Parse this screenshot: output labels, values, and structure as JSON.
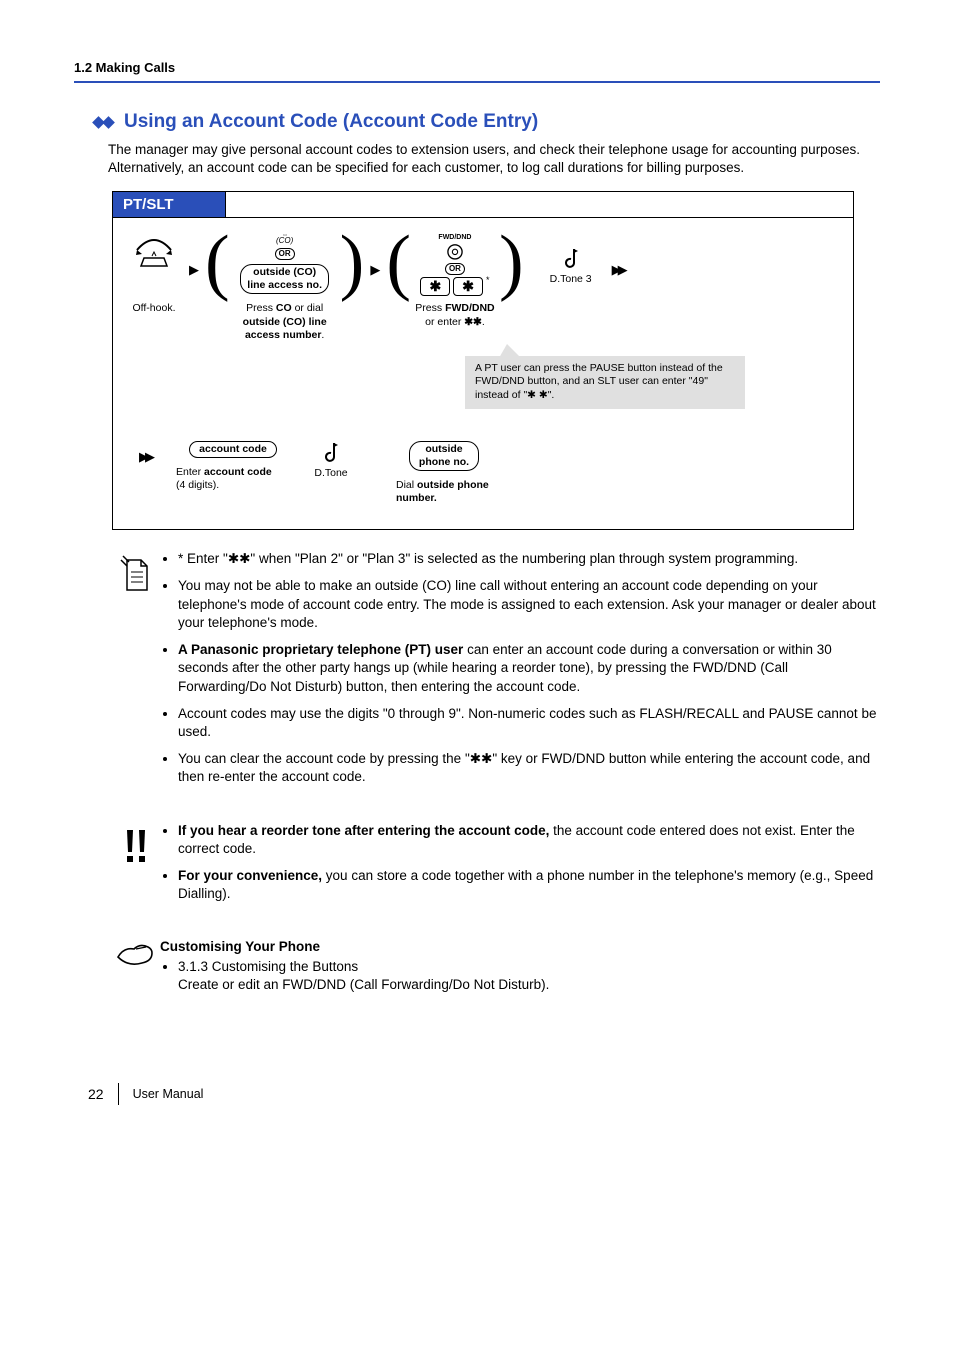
{
  "header": {
    "breadcrumb": "1.2 Making Calls"
  },
  "title": "Using an Account Code (Account Code Entry)",
  "intro": "The manager may give personal account codes to extension users, and check their telephone usage for accounting purposes. Alternatively, an account code can be specified for each customer, to log call durations for billing purposes.",
  "diagram": {
    "tab": "PT/SLT",
    "steps": {
      "s1_caption": "Off-hook.",
      "s2_btn": "(CO)",
      "s2_or": "OR",
      "s2_pill1": "outside (CO)",
      "s2_pill2": "line access no.",
      "s2_caption_a": "Press ",
      "s2_caption_b": "CO",
      "s2_caption_c": " or dial ",
      "s2_caption_d": "outside (CO) line access number",
      "s2_caption_e": ".",
      "s3_top": "FWD/DND",
      "s3_or": "OR",
      "s3_keys": "✱  ✱",
      "s3_star_sup": "*",
      "s3_caption_a": "Press ",
      "s3_caption_b": "FWD/DND",
      "s3_caption_c": "or enter ",
      "s3_caption_d": "✱✱",
      "s3_caption_e": ".",
      "s4_label": "D.Tone 3",
      "callout_text": "A PT user can press the PAUSE button instead of the FWD/DND button, and an SLT user can enter \"49\" instead of \"✱ ✱\".",
      "r2_pill": "account code",
      "r2_caption_a": "Enter ",
      "r2_caption_b": "account code",
      "r2_caption_c": "(4 digits).",
      "r2_tone": "D.Tone",
      "r2_pill2a": "outside",
      "r2_pill2b": "phone no.",
      "r2_caption2a": "Dial ",
      "r2_caption2b": "outside phone number."
    }
  },
  "notes1": [
    "* Enter \"✱✱\" when \"Plan 2\" or \"Plan 3\" is selected as the numbering plan through system programming.",
    "You may not be able to make an outside (CO) line call without entering an account code depending on your telephone's mode of account code entry. The mode is assigned to each extension. Ask your manager or dealer about your telephone's mode.",
    "__bold__A Panasonic proprietary telephone (PT) user__end__ can enter an account code during a conversation or within 30 seconds after the other party hangs up (while hearing a reorder tone), by pressing the FWD/DND (Call Forwarding/Do Not Disturb) button, then entering the account code.",
    "Account codes may use the digits \"0 through 9\". Non-numeric codes such as FLASH/RECALL and PAUSE cannot be used.",
    "You can clear the account code by pressing the \"✱✱\" key or FWD/DND button while entering the account code, and then re-enter the account code."
  ],
  "notes2": [
    "__bold__If you hear a reorder tone after entering the account code,__end__ the account code entered does not exist. Enter the correct code.",
    "__bold__For your convenience,__end__ you can store a code together with a phone number in the telephone's memory (e.g., Speed Dialling)."
  ],
  "notes3": {
    "heading": "Customising Your Phone",
    "item1": "3.1.3 Customising the Buttons",
    "item2": "Create or edit an FWD/DND (Call Forwarding/Do Not Disturb)."
  },
  "footer": {
    "page": "22",
    "label": "User Manual"
  }
}
